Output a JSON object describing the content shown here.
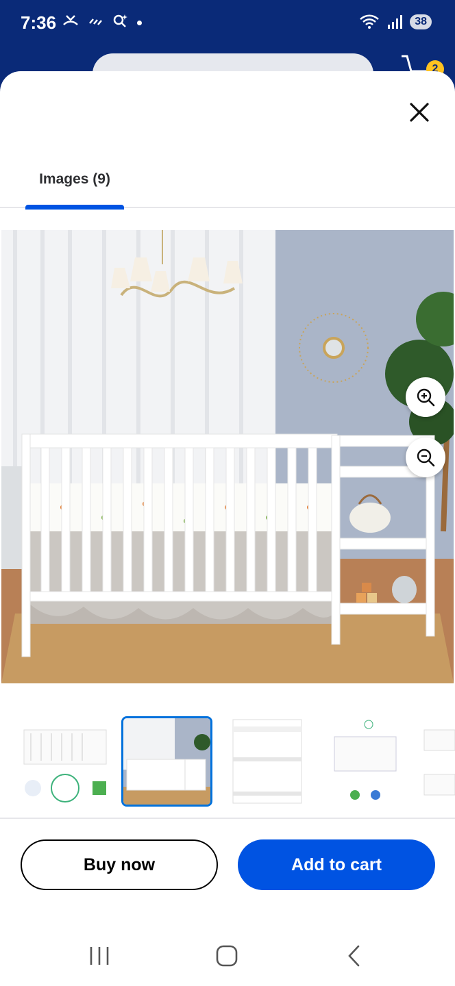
{
  "status_bar": {
    "time": "7:36",
    "battery": "38"
  },
  "header": {
    "cart_count": "2"
  },
  "sheet": {
    "tab_label": "Images (9)",
    "main_image_alt": "White convertible crib with attached changing table in a nursery",
    "thumbnails": [
      "thumb-1",
      "thumb-2",
      "thumb-3",
      "thumb-4",
      "thumb-5"
    ]
  },
  "actions": {
    "buy_now": "Buy now",
    "add_to_cart": "Add to cart"
  },
  "colors": {
    "brand_blue": "#0053e2",
    "header_navy": "#0a2a78",
    "badge_yellow": "#ffc220"
  }
}
